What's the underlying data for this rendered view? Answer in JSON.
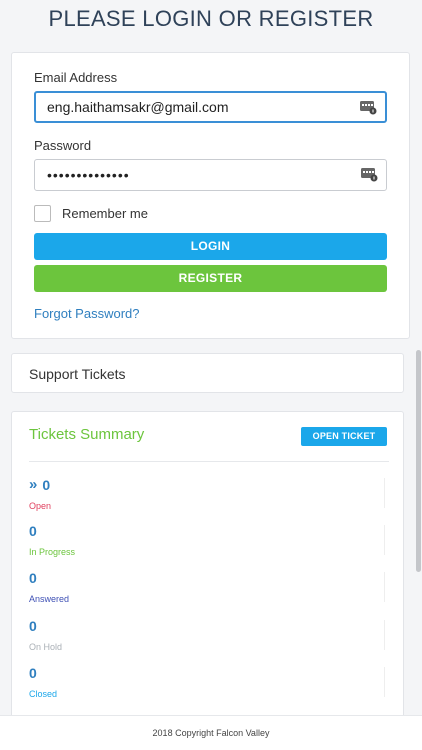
{
  "page": {
    "title": "PLEASE LOGIN OR REGISTER"
  },
  "login": {
    "email_label": "Email Address",
    "email_value": "eng.haithamsakr@gmail.com",
    "password_label": "Password",
    "password_value": "••••••••••••••",
    "remember_label": "Remember me",
    "remember_checked": false,
    "login_button": "LOGIN",
    "register_button": "REGISTER",
    "forgot_link": "Forgot Password?"
  },
  "support": {
    "title": "Support Tickets"
  },
  "summary": {
    "title": "Tickets Summary",
    "open_ticket_button": "OPEN TICKET",
    "stats": [
      {
        "count": "0",
        "label": "Open",
        "color": "#e0405e",
        "icon": "double-chevron-right-icon"
      },
      {
        "count": "0",
        "label": "In Progress",
        "color": "#6cc53d"
      },
      {
        "count": "0",
        "label": "Answered",
        "color": "#3f51b5"
      },
      {
        "count": "0",
        "label": "On Hold",
        "color": "#aab0b6"
      },
      {
        "count": "0",
        "label": "Closed",
        "color": "#1ba7ea"
      }
    ]
  },
  "footer": {
    "text": "2018 Copyright Falcon Valley"
  },
  "colors": {
    "primary": "#1ba7ea",
    "success": "#6cc53d",
    "link": "#2f7fbf",
    "title": "#2f4259"
  }
}
